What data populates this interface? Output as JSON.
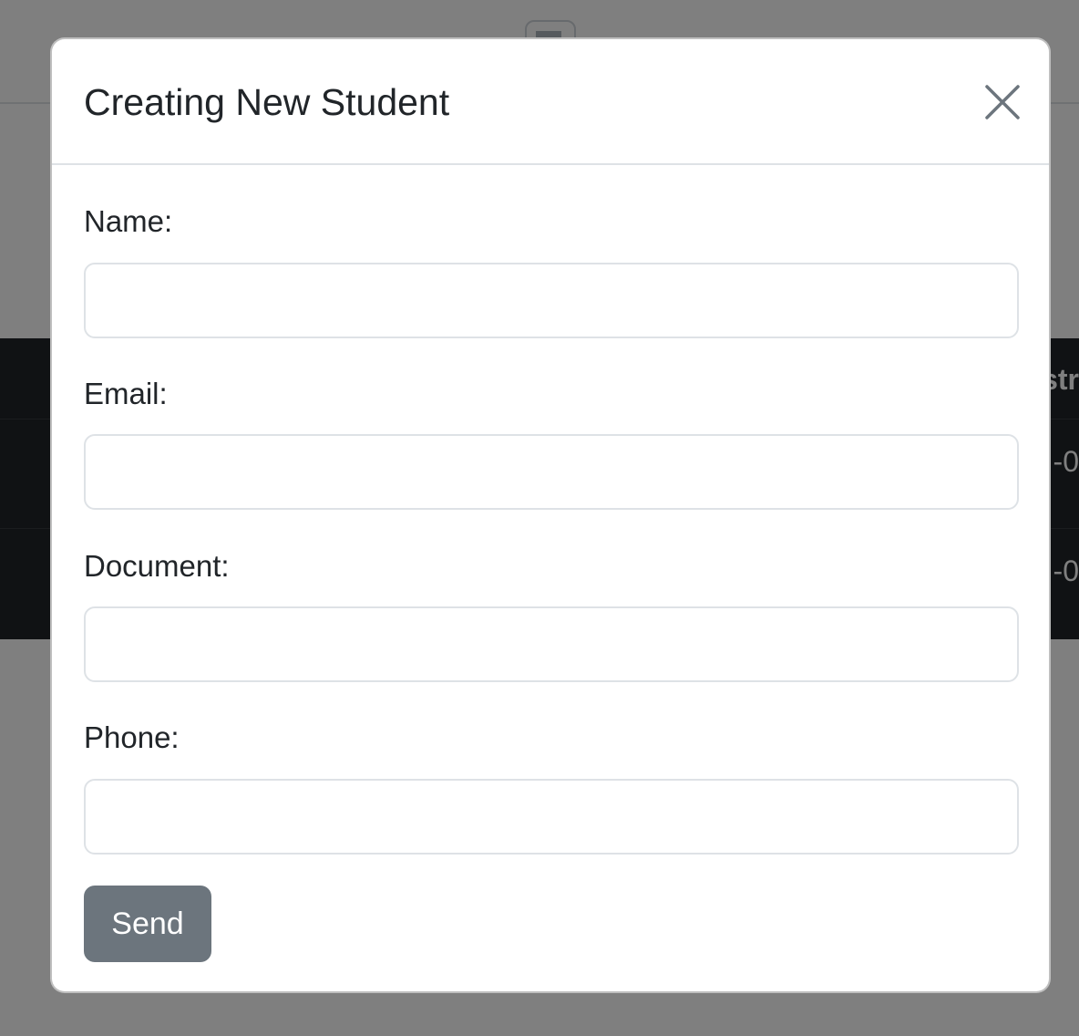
{
  "background": {
    "table_header_fragment": "str",
    "row_fragments": [
      "-0",
      "-0"
    ]
  },
  "modal": {
    "title": "Creating New Student",
    "close_icon": "close-icon",
    "fields": [
      {
        "label": "Name:",
        "value": "",
        "placeholder": ""
      },
      {
        "label": "Email:",
        "value": "",
        "placeholder": ""
      },
      {
        "label": "Document:",
        "value": "",
        "placeholder": ""
      },
      {
        "label": "Phone:",
        "value": "",
        "placeholder": ""
      }
    ],
    "submit_label": "Send"
  },
  "colors": {
    "submit_button": "#6c757d",
    "backdrop": "rgba(0,0,0,0.5)",
    "table_bg": "#212529"
  }
}
